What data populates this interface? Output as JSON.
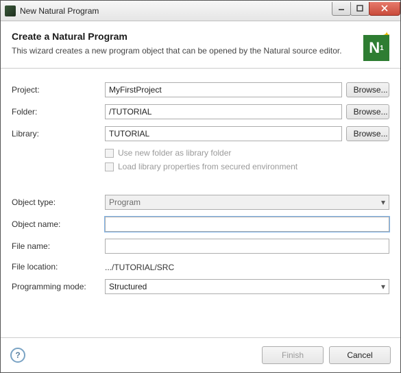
{
  "titlebar": {
    "text": "New Natural Program"
  },
  "header": {
    "title": "Create a Natural Program",
    "subtitle": "This wizard creates a new program object that can be opened by the Natural source editor."
  },
  "labels": {
    "project": "Project:",
    "folder": "Folder:",
    "library": "Library:",
    "object_type": "Object type:",
    "object_name": "Object name:",
    "file_name": "File name:",
    "file_location": "File location:",
    "programming_mode": "Programming mode:"
  },
  "values": {
    "project": "MyFirstProject",
    "folder": "/TUTORIAL",
    "library": "TUTORIAL",
    "object_type": "Program",
    "object_name": "",
    "file_name": "",
    "file_location": ".../TUTORIAL/SRC",
    "programming_mode": "Structured"
  },
  "checkboxes": {
    "use_new_folder": "Use new folder as library folder",
    "load_library_props": "Load library properties from secured environment"
  },
  "buttons": {
    "browse": "Browse...",
    "finish": "Finish",
    "cancel": "Cancel"
  },
  "help_glyph": "?"
}
